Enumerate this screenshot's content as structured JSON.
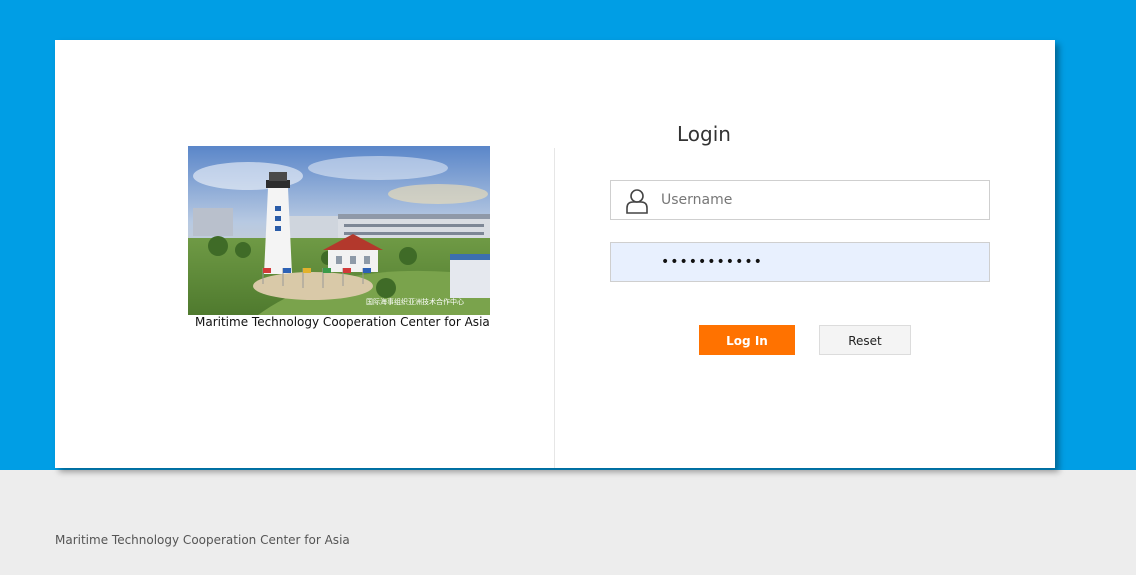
{
  "page": {
    "background_top": "#009ee5",
    "background_bottom": "#ededed"
  },
  "left_panel": {
    "photo_icon": "lighthouse-campus-photo",
    "photo_watermark": "国际海事组织亚洲技术合作中心",
    "caption": "Maritime Technology Cooperation Center for Asia"
  },
  "login": {
    "title": "Login",
    "username": {
      "icon": "user-icon",
      "placeholder": "Username",
      "value": ""
    },
    "password": {
      "value": "•••••••••••"
    },
    "login_button_label": "Log In",
    "reset_button_label": "Reset",
    "accent_color": "#ff7200"
  },
  "footer": {
    "text": "Maritime Technology Cooperation Center for Asia"
  }
}
